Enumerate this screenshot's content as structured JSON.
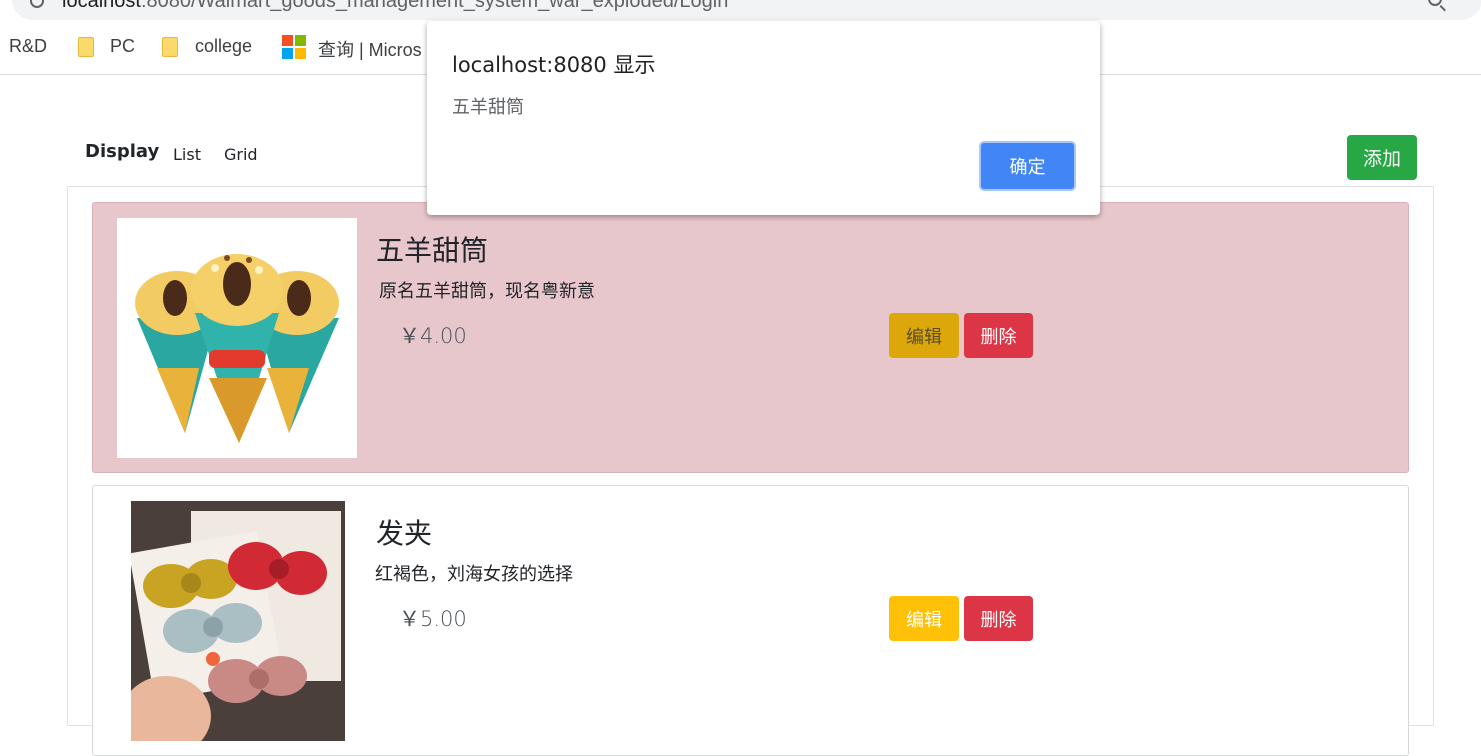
{
  "browser": {
    "url_host": "localhost",
    "url_rest": ":8080/Walmart_goods_management_system_war_exploded/Login",
    "bookmarks": [
      {
        "label": "R&D"
      },
      {
        "label": "PC",
        "icon": "folder-icon"
      },
      {
        "label": "college",
        "icon": "folder-icon"
      },
      {
        "label": "查询 | Micros",
        "icon": "microsoft-icon"
      }
    ]
  },
  "nav": {
    "brand": "Display",
    "links": [
      "List",
      "Grid"
    ],
    "add_label": "添加"
  },
  "products": [
    {
      "title": "五羊甜筒",
      "description": "原名五羊甜筒，现名粤新意",
      "price": "￥4.00",
      "image": "ice-cream-cones-image",
      "edit_label": "编辑",
      "delete_label": "删除"
    },
    {
      "title": "发夹",
      "description": "红褐色，刘海女孩的选择",
      "price": "￥5.00",
      "image": "hair-clips-image",
      "edit_label": "编辑",
      "delete_label": "删除"
    }
  ],
  "dialog": {
    "title": "localhost:8080 显示",
    "message": "五羊甜筒",
    "ok_label": "确定"
  },
  "colors": {
    "selected_card_bg": "#e8c7cc",
    "add_button": "#28a745",
    "edit_button": "#ffc107",
    "delete_button": "#dc3545",
    "dialog_ok": "#4285f4"
  }
}
